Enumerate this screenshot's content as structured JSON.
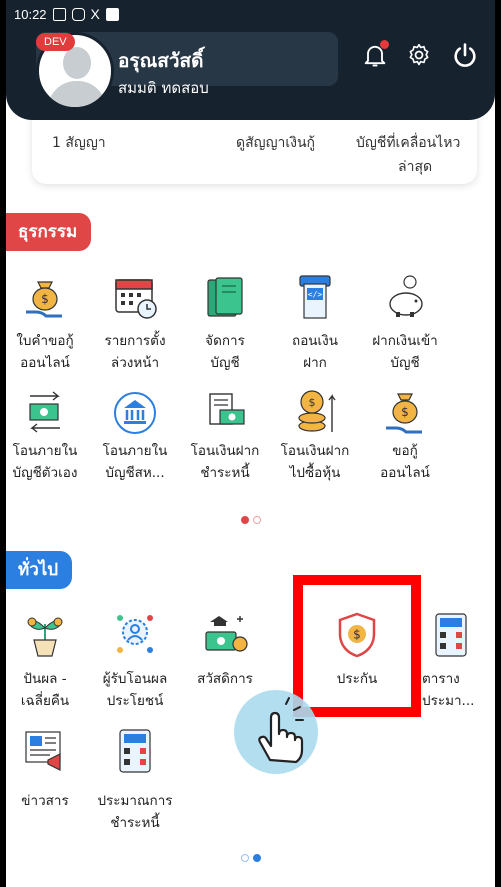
{
  "status_bar": {
    "time": "10:22",
    "icons": [
      "image-icon",
      "instagram-icon",
      "x-icon",
      "square-icon"
    ]
  },
  "header": {
    "dev_badge": "DEV",
    "name": "อรุณสวัสดิ์",
    "sub": "สมมติ ทดสอบ",
    "actions": [
      "bell-icon",
      "gear-icon",
      "power-icon"
    ]
  },
  "summary": {
    "contract_count": "1 สัญญา",
    "view_contract": "ดูสัญญาเงินกู้",
    "recent_account_line1": "บัญชีที่เคลื่อนไหว",
    "recent_account_line2": "ล่าสุด"
  },
  "transactions": {
    "title": "ธุรกรรม",
    "items": [
      {
        "l1": "ใบคำขอกู้",
        "l2": "ออนไลน์",
        "icon": "money-bag-hand-icon"
      },
      {
        "l1": "รายการตั้ง",
        "l2": "ล่วงหน้า",
        "icon": "calendar-clock-icon"
      },
      {
        "l1": "จัดการ",
        "l2": "บัญชี",
        "icon": "passbook-icon"
      },
      {
        "l1": "ถอนเงิน",
        "l2": "ฝาก",
        "icon": "atm-withdraw-icon"
      },
      {
        "l1": "ฝากเงินเข้า",
        "l2": "บัญชี",
        "icon": "piggy-bank-icon"
      },
      {
        "l1": "โอนภายใน",
        "l2": "บัญชีตัวเอง",
        "icon": "transfer-arrows-icon"
      },
      {
        "l1": "โอนภายใน",
        "l2": "บัญชีสห...",
        "icon": "bank-building-icon"
      },
      {
        "l1": "โอนเงินฝาก",
        "l2": "ชำระหนี้",
        "icon": "bill-payment-icon"
      },
      {
        "l1": "โอนเงินฝาก",
        "l2": "ไปซื้อหุ้น",
        "icon": "coins-stock-icon"
      },
      {
        "l1": "ขอกู้",
        "l2": "ออนไลน์",
        "icon": "money-bag-hand-icon"
      }
    ]
  },
  "general": {
    "title": "ทั่วไป",
    "items": [
      {
        "l1": "ปันผล -",
        "l2": "เฉลี่ยคืน",
        "icon": "plant-coins-icon"
      },
      {
        "l1": "ผู้รับโอนผล",
        "l2": "ประโยชน์",
        "icon": "beneficiary-icon"
      },
      {
        "l1": "สวัสดิการ",
        "l2": "",
        "icon": "welfare-icon"
      },
      {
        "l1": "ประกัน",
        "l2": "",
        "icon": "insurance-shield-icon"
      },
      {
        "l1": "ตาราง",
        "l2": "ประมา...",
        "icon": "calculator-icon"
      },
      {
        "l1": "ข่าวสาร",
        "l2": "",
        "icon": "news-megaphone-icon"
      },
      {
        "l1": "ประมาณการ",
        "l2": "ชำระหนี้",
        "icon": "calculator-icon"
      }
    ]
  },
  "colors": {
    "header_bg": "#16232f",
    "accent_red": "#e04646",
    "accent_blue": "#2b7fe0",
    "highlight": "#ff0000"
  }
}
